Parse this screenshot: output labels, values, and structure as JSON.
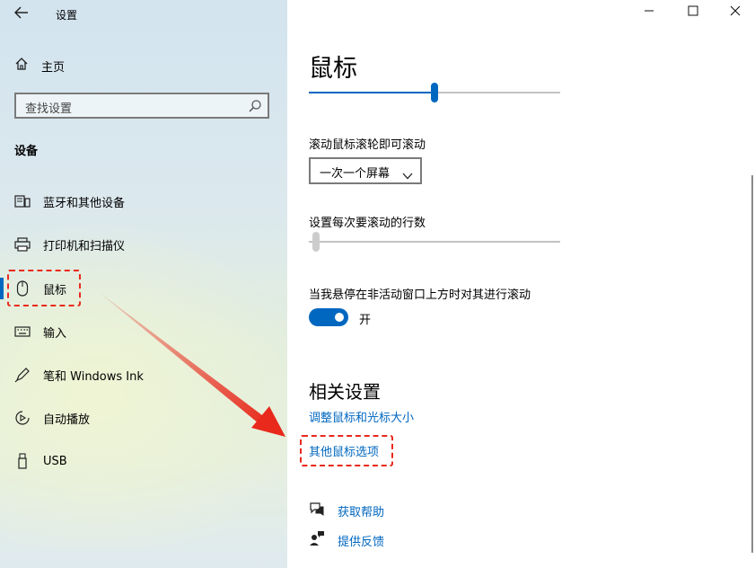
{
  "window": {
    "title": "设置",
    "back_icon": "back-arrow-icon",
    "minimize_icon": "minimize-icon",
    "maximize_icon": "maximize-icon",
    "close_icon": "close-icon"
  },
  "sidebar": {
    "home_label": "主页",
    "search_placeholder": "查找设置",
    "section_label": "设备",
    "items": [
      {
        "label": "蓝牙和其他设备",
        "icon": "bluetooth-devices-icon"
      },
      {
        "label": "打印机和扫描仪",
        "icon": "printer-icon"
      },
      {
        "label": "鼠标",
        "icon": "mouse-icon",
        "selected": true
      },
      {
        "label": "输入",
        "icon": "keyboard-icon"
      },
      {
        "label": "笔和 Windows Ink",
        "icon": "pen-icon"
      },
      {
        "label": "自动播放",
        "icon": "autoplay-icon"
      },
      {
        "label": "USB",
        "icon": "usb-icon"
      }
    ]
  },
  "main": {
    "page_title": "鼠标",
    "top_slider_level": 0.5,
    "scroll_label": "滚动鼠标滚轮即可滚动",
    "scroll_dropdown_value": "一次一个屏幕",
    "lines_label": "设置每次要滚动的行数",
    "lines_slider_level": 0.0,
    "inactive_scroll_label": "当我悬停在非活动窗口上方时对其进行滚动",
    "inactive_toggle_state": "开",
    "related_heading": "相关设置",
    "related_links": [
      "调整鼠标和光标大小",
      "其他鼠标选项"
    ],
    "help_link": "获取帮助",
    "feedback_link": "提供反馈"
  },
  "colors": {
    "accent": "#0067c0",
    "highlight_annotation": "#e8291c"
  }
}
